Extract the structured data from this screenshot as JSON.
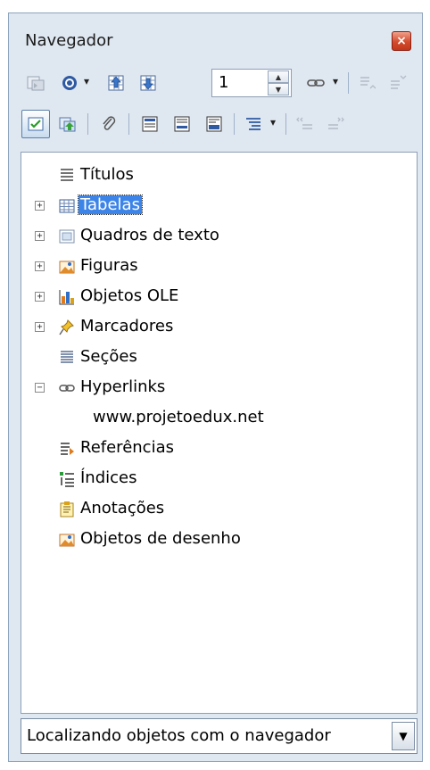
{
  "window": {
    "title": "Navegador",
    "close_symbol": "×"
  },
  "toolbar1": {
    "page_value": "1",
    "spin_up": "▲",
    "spin_down": "▼",
    "dropdown": "▾",
    "icons": [
      "toggle-view-icon",
      "navigation-icon",
      "previous-icon",
      "next-icon",
      "page-spin",
      "hyperlink-drag-icon",
      "promote-level-icon",
      "demote-level-icon"
    ]
  },
  "toolbar2": {
    "dropdown": "▾",
    "icons": [
      "content-view-icon",
      "reminder-icon",
      "paperclip-icon",
      "header-icon",
      "footer-icon",
      "anchor-icon",
      "heading-levels-icon",
      "chapter-up-icon",
      "chapter-down-icon"
    ]
  },
  "tree": {
    "items": [
      {
        "label": "Títulos",
        "expander": "",
        "icon": "headings-icon"
      },
      {
        "label": "Tabelas",
        "expander": "+",
        "icon": "table-icon",
        "selected": true
      },
      {
        "label": "Quadros de texto",
        "expander": "+",
        "icon": "text-frame-icon"
      },
      {
        "label": "Figuras",
        "expander": "+",
        "icon": "graphics-icon"
      },
      {
        "label": "Objetos OLE",
        "expander": "+",
        "icon": "ole-object-icon"
      },
      {
        "label": "Marcadores",
        "expander": "+",
        "icon": "bookmark-icon"
      },
      {
        "label": "Seções",
        "expander": "",
        "icon": "sections-icon"
      },
      {
        "label": "Hyperlinks",
        "expander": "−",
        "icon": "hyperlink-icon"
      },
      {
        "label": "www.projetoedux.net",
        "expander": "",
        "icon": ""
      },
      {
        "label": "Referências",
        "expander": "",
        "icon": "references-icon"
      },
      {
        "label": "Índices",
        "expander": "",
        "icon": "indexes-icon"
      },
      {
        "label": "Anotações",
        "expander": "",
        "icon": "comments-icon"
      },
      {
        "label": "Objetos de desenho",
        "expander": "",
        "icon": "drawing-objects-icon"
      }
    ]
  },
  "document_select": {
    "value": "Localizando objetos com o navegador",
    "arrow": "▼"
  }
}
